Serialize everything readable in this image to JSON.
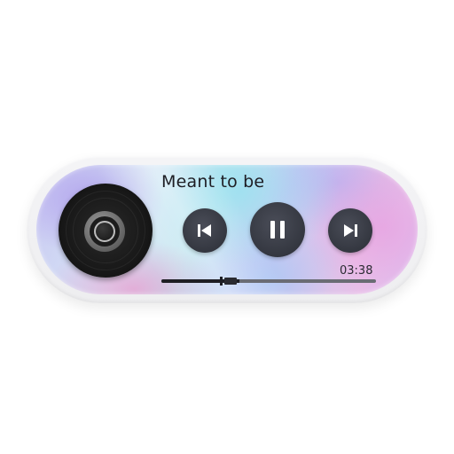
{
  "player": {
    "track_title": "Meant to be",
    "elapsed_time": "03:38",
    "progress_fraction": 0.32,
    "icons": {
      "disc": "vinyl-disc-icon",
      "previous": "skip-previous-icon",
      "pause": "pause-icon",
      "next": "skip-next-icon"
    },
    "colors": {
      "button": "#343740",
      "icon": "#ffffff",
      "text": "#1e1e24",
      "track": "#6a6c74"
    }
  }
}
